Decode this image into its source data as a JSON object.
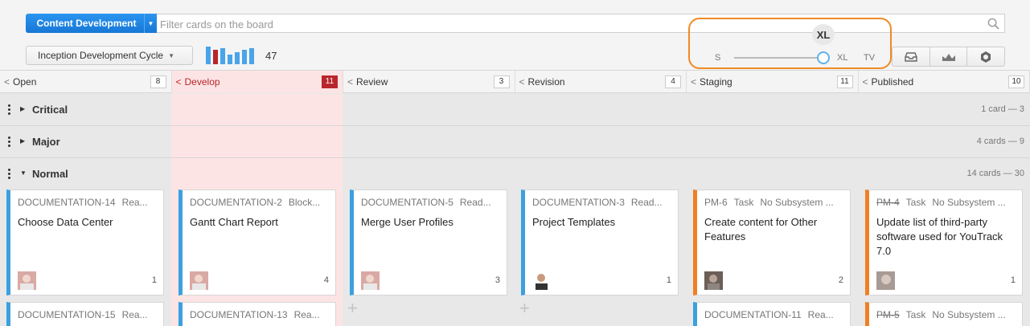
{
  "toolbar": {
    "project_label": "Content Development",
    "filter_placeholder": "Filter cards on the board",
    "sprint_label": "Inception Development Cycle",
    "card_count": "47",
    "mini_chart_values": [
      22,
      18,
      20,
      12,
      15,
      18,
      20
    ]
  },
  "zoom": {
    "current": "XL",
    "labels": [
      "S",
      "XL",
      "TV"
    ]
  },
  "columns": [
    {
      "name": "Open",
      "count": "8"
    },
    {
      "name": "Develop",
      "count": "11"
    },
    {
      "name": "Review",
      "count": "3"
    },
    {
      "name": "Revision",
      "count": "4"
    },
    {
      "name": "Staging",
      "count": "11"
    },
    {
      "name": "Published",
      "count": "10"
    }
  ],
  "swimlanes": [
    {
      "name": "Critical",
      "info": "1 card  —  3"
    },
    {
      "name": "Major",
      "info": "4 cards  —  9"
    },
    {
      "name": "Normal",
      "info": "14 cards  —  30"
    }
  ],
  "cards": [
    {
      "id": "DOCUMENTATION-14",
      "type": "Rea...",
      "summary": "Choose Data Center",
      "estimate": "1"
    },
    {
      "id": "DOCUMENTATION-2",
      "type": "Block...",
      "summary": "Gantt Chart Report",
      "estimate": "4"
    },
    {
      "id": "DOCUMENTATION-5",
      "type": "Read...",
      "summary": "Merge User Profiles",
      "estimate": "3"
    },
    {
      "id": "DOCUMENTATION-3",
      "type": "Read...",
      "summary": "Project Templates",
      "estimate": "1"
    },
    {
      "id": "PM-6",
      "type": "Task",
      "subsystem": "No Subsystem ...",
      "summary": "Create content for Other Features",
      "estimate": "2"
    },
    {
      "id": "PM-4",
      "type": "Task",
      "subsystem": "No Subsystem ...",
      "summary": "Update list of third-party software used for YouTrack 7.0",
      "estimate": "1"
    }
  ],
  "next_cards": [
    {
      "id": "DOCUMENTATION-15",
      "type": "Rea..."
    },
    {
      "id": "DOCUMENTATION-13",
      "type": "Rea..."
    },
    {
      "id": "DOCUMENTATION-11",
      "type": "Rea..."
    },
    {
      "id": "PM-5",
      "type": "Task",
      "subsystem": "No Subsystem ..."
    }
  ]
}
